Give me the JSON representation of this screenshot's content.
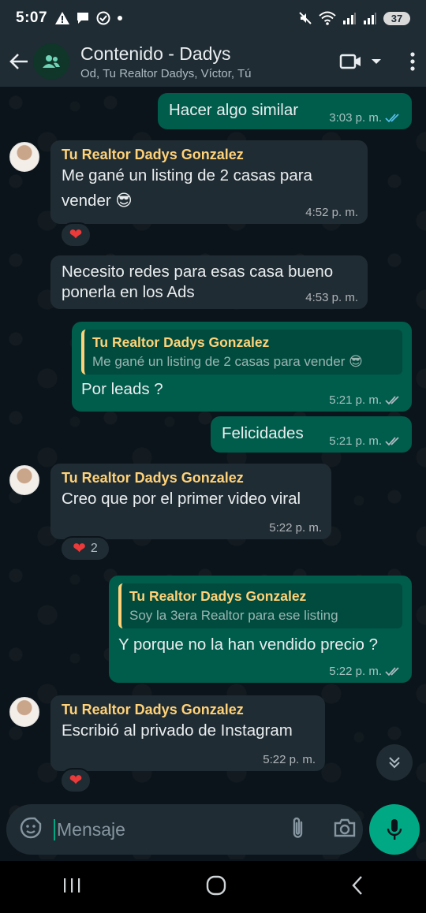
{
  "status_bar": {
    "time": "5:07",
    "battery": "37"
  },
  "header": {
    "title": "Contenido - Dadys",
    "subtitle": "Od, Tu Realtor Dadys, Víctor, Tú"
  },
  "messages": [
    {
      "direction": "out",
      "text": "Hacer algo similar",
      "time": "3:03 p. m.",
      "ticks": "read"
    },
    {
      "direction": "in",
      "sender": "Tu Realtor Dadys Gonzalez",
      "text_line1": "Me gané un listing de 2 casas para",
      "text_line2": "vender 😎",
      "time": "4:52 p. m.",
      "reaction": "❤️"
    },
    {
      "direction": "in",
      "text_line1": "Necesito redes para esas casa bueno",
      "text_line2": "ponerla en los Ads",
      "time": "4:53 p. m."
    },
    {
      "direction": "out",
      "quote_name": "Tu Realtor Dadys Gonzalez",
      "quote_text": "Me gané un listing de 2 casas para vender 😎",
      "text": "Por leads ?",
      "time": "5:21 p. m.",
      "ticks": "delivered"
    },
    {
      "direction": "out",
      "text": "Felicidades",
      "time": "5:21 p. m.",
      "ticks": "delivered"
    },
    {
      "direction": "in",
      "sender": "Tu Realtor Dadys Gonzalez",
      "text": "Creo que por el primer video viral",
      "time": "5:22 p. m.",
      "reaction": "❤️",
      "reaction_count": "2"
    },
    {
      "direction": "out",
      "quote_name": "Tu Realtor Dadys Gonzalez",
      "quote_text": "Soy la 3era Realtor para ese listing",
      "text": "Y porque no la han vendido precio ?",
      "time": "5:22 p. m.",
      "ticks": "delivered"
    },
    {
      "direction": "in",
      "sender": "Tu Realtor Dadys Gonzalez",
      "text": "Escribió al privado de Instagram",
      "time": "5:22 p. m.",
      "reaction": "❤️"
    }
  ],
  "composer": {
    "placeholder": "Mensaje"
  },
  "colors": {
    "accent": "#00a884",
    "outgoing_bubble": "#005c4b",
    "incoming_bubble": "#202c33",
    "sender_name": "#ffd279",
    "read_ticks": "#53bdeb"
  }
}
